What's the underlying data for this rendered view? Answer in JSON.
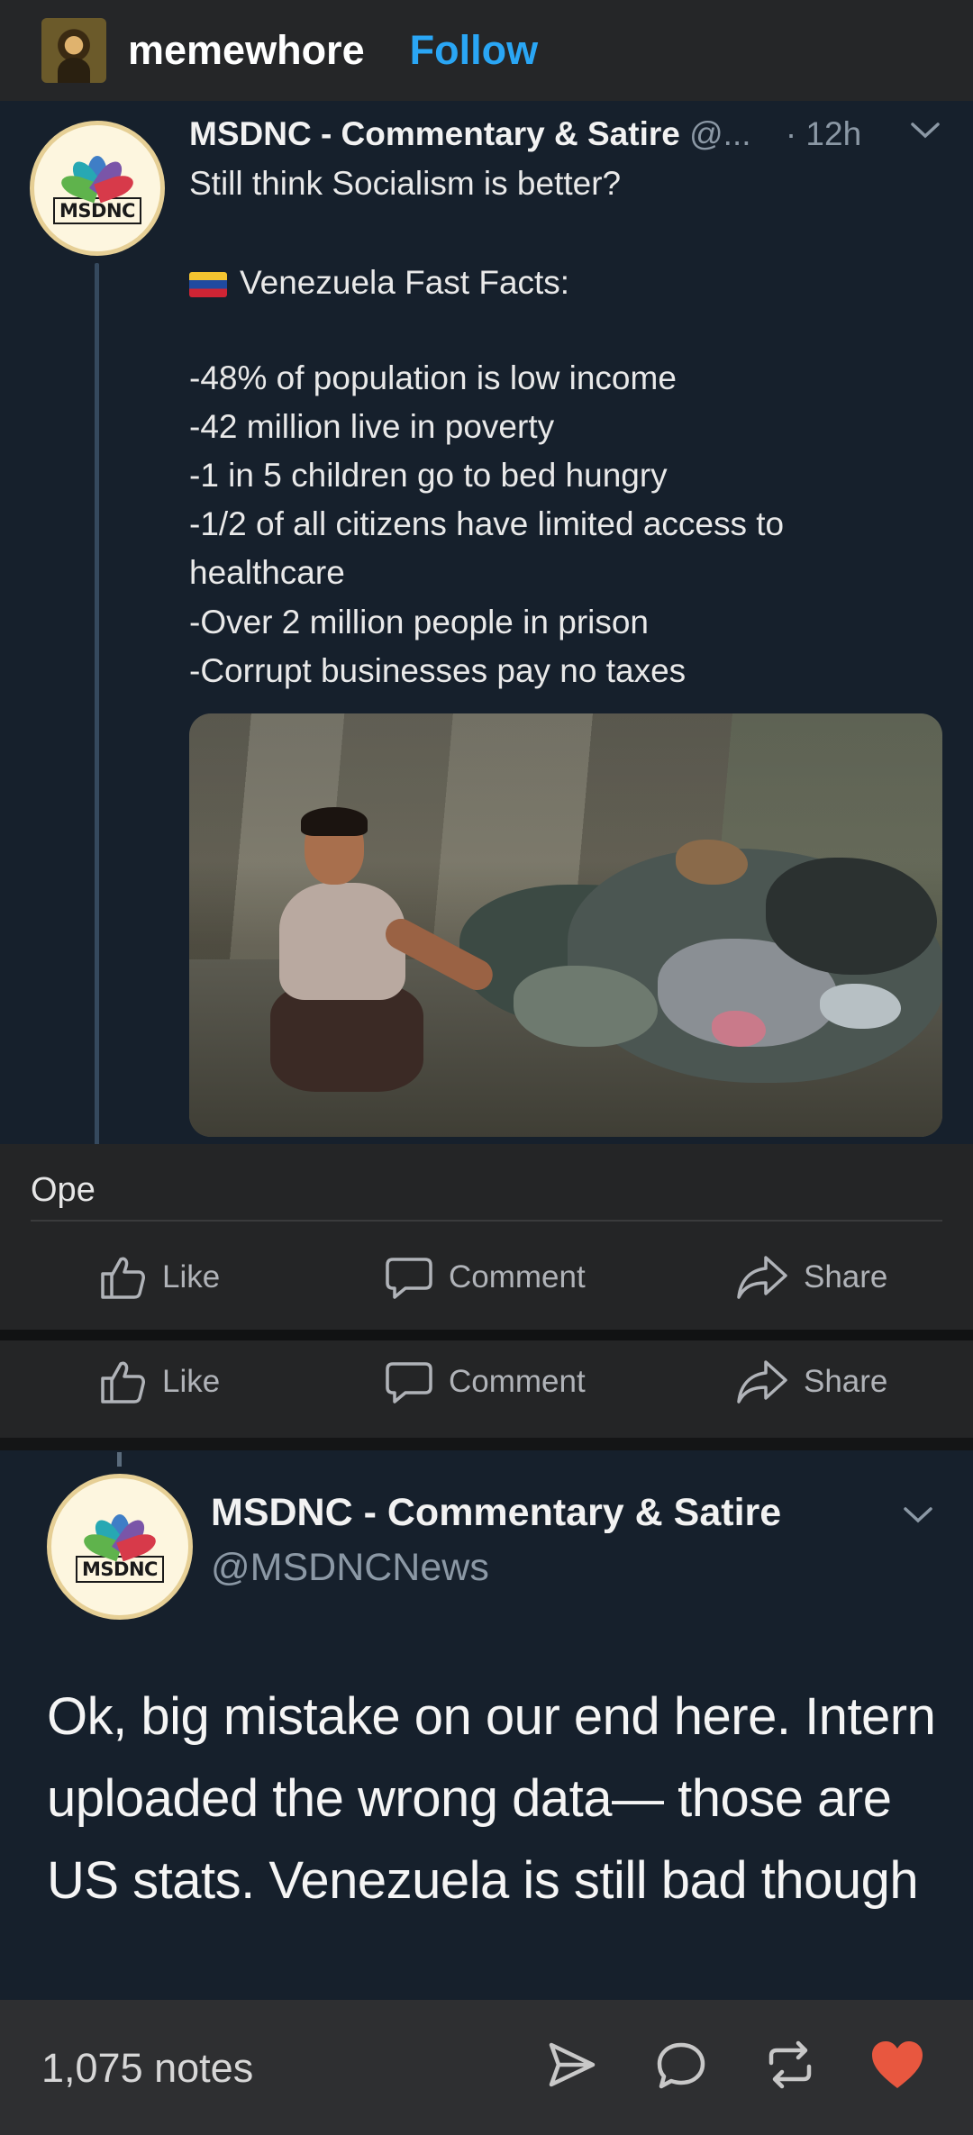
{
  "header": {
    "username": "memewhore",
    "follow_label": "Follow"
  },
  "tweet1": {
    "logo_text": "MSDNC",
    "account_name": "MSDNC - Commentary & Satire",
    "handle_truncated": "@...",
    "time": "· 12h",
    "lines": [
      "Still think Socialism is better?",
      "Venezuela Fast Facts:",
      "-48% of population is low income",
      "-42 million live in poverty",
      "-1 in 5 children go to bed hungry",
      "-1/2 of all citizens have limited access to",
      "healthcare",
      "-Over 2 million people in prison",
      "-Corrupt businesses pay no taxes"
    ]
  },
  "post": {
    "caption": "Ope",
    "actions": {
      "like": "Like",
      "comment": "Comment",
      "share": "Share"
    }
  },
  "tweet2": {
    "logo_text": "MSDNC",
    "account_name": "MSDNC - Commentary & Satire",
    "handle": "@MSDNCNews",
    "text": "Ok, big mistake on our end here. Intern uploaded the wrong data— those are US stats. Venezuela is still bad though"
  },
  "footer": {
    "notes": "1,075 notes",
    "icons": [
      "send-icon",
      "reply-icon",
      "reblog-icon",
      "heart-icon"
    ],
    "heart_color": "#e8573f"
  },
  "colors": {
    "follow": "#2aa6f5",
    "tweet_bg": "#16202c",
    "header_bg": "#252628"
  }
}
